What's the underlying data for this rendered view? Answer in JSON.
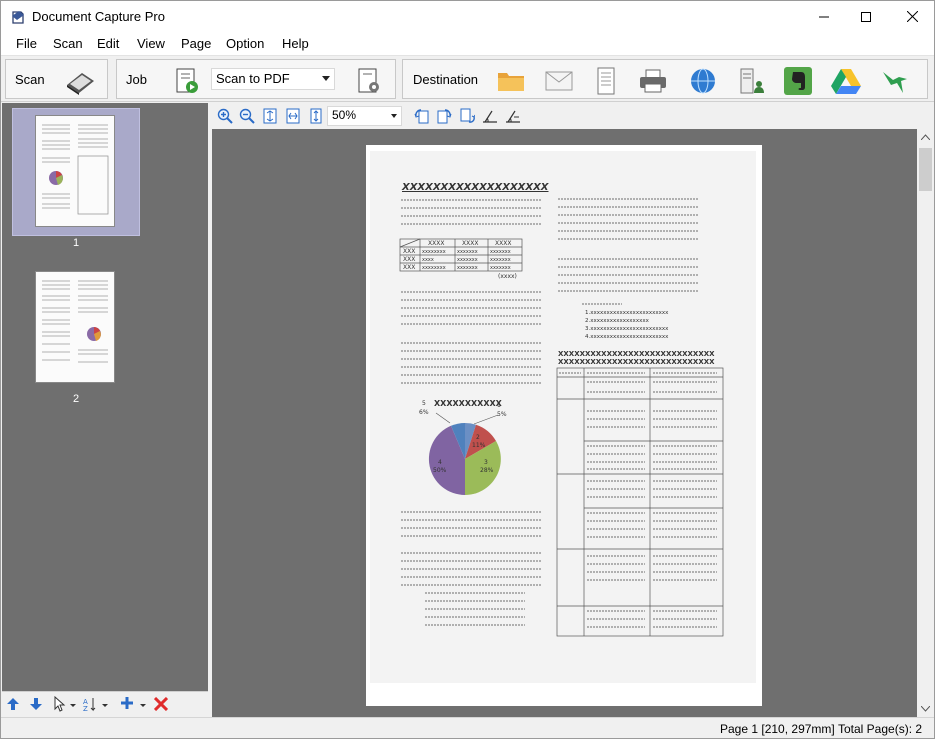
{
  "window": {
    "title": "Document Capture Pro"
  },
  "menu": [
    "File",
    "Scan",
    "Edit",
    "View",
    "Page",
    "Option",
    "Help"
  ],
  "toolbar": {
    "scan_label": "Scan",
    "job_label": "Job",
    "job_value": "Scan to PDF",
    "destination_label": "Destination"
  },
  "thumbnails": [
    {
      "number": "1",
      "selected": true
    },
    {
      "number": "2",
      "selected": false
    }
  ],
  "view_toolbar": {
    "zoom": "50%"
  },
  "document": {
    "heading": "XXXXXXXXXXXXXXXXXXX",
    "table_headers": [
      "XXXX",
      "XXXX",
      "XXXX"
    ],
    "table_rows": [
      [
        "XXX",
        "xxxxxxxx",
        "xxxxxxx",
        "xxxxxxx"
      ],
      [
        "XXX",
        "xxxx",
        "xxxxxxx",
        "xxxxxxx"
      ],
      [
        "XXX",
        "xxxxxxxx",
        "xxxxxxx",
        "xxxxxxx"
      ]
    ],
    "table_note": "(xxxx)",
    "pie_title": "XXXXXXXXXXX",
    "pie_labels": [
      "1\n5%",
      "2\n11%",
      "3\n28%",
      "4\n50%",
      "5\n6%"
    ],
    "list_items": [
      "1.xxxxxxxxxxxxxxxxxxxxxxxx",
      "2.xxxxxxxxxxxxxxxxxx",
      "3.xxxxxxxxxxxxxxxxxxxxxxxx",
      "4.xxxxxxxxxxxxxxxxxxxxxxxx"
    ],
    "right_heading": "XXXXXXXXXXXXXXXXXXXXXXXXXXXXX"
  },
  "status": {
    "page": "Page 1 [210, 297mm]",
    "total": "Total Page(s): 2"
  }
}
